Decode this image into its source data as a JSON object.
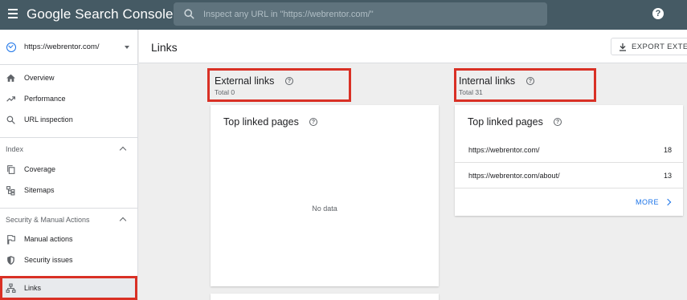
{
  "app": {
    "title": "Google Search Console",
    "search_placeholder": "Inspect any URL in \"https://webrentor.com/\"",
    "help_icon": "?"
  },
  "sidebar": {
    "property": "https://webrentor.com/",
    "items": [
      {
        "label": "Overview",
        "icon": "home-icon"
      },
      {
        "label": "Performance",
        "icon": "trending-up-icon"
      },
      {
        "label": "URL inspection",
        "icon": "search-icon"
      }
    ],
    "index_section": "Index",
    "index_items": [
      {
        "label": "Coverage",
        "icon": "copy-icon"
      },
      {
        "label": "Sitemaps",
        "icon": "sitemap-icon"
      }
    ],
    "security_section": "Security & Manual Actions",
    "security_items": [
      {
        "label": "Manual actions",
        "icon": "flag-icon"
      },
      {
        "label": "Security issues",
        "icon": "shield-icon"
      }
    ],
    "links_item": {
      "label": "Links",
      "icon": "network-icon"
    }
  },
  "header": {
    "title": "Links",
    "export_label": "EXPORT EXTERN"
  },
  "external": {
    "title": "External links",
    "total": "Total 0",
    "card_title": "Top linked pages",
    "no_data": "No data"
  },
  "internal": {
    "title": "Internal links",
    "total": "Total 31",
    "card_title": "Top linked pages",
    "rows": [
      {
        "url": "https://webrentor.com/",
        "count": "18"
      },
      {
        "url": "https://webrentor.com/about/",
        "count": "13"
      }
    ],
    "more_label": "MORE"
  },
  "colors": {
    "topbar": "#455a64",
    "accent": "#1a73e8",
    "highlight": "#d93025"
  }
}
